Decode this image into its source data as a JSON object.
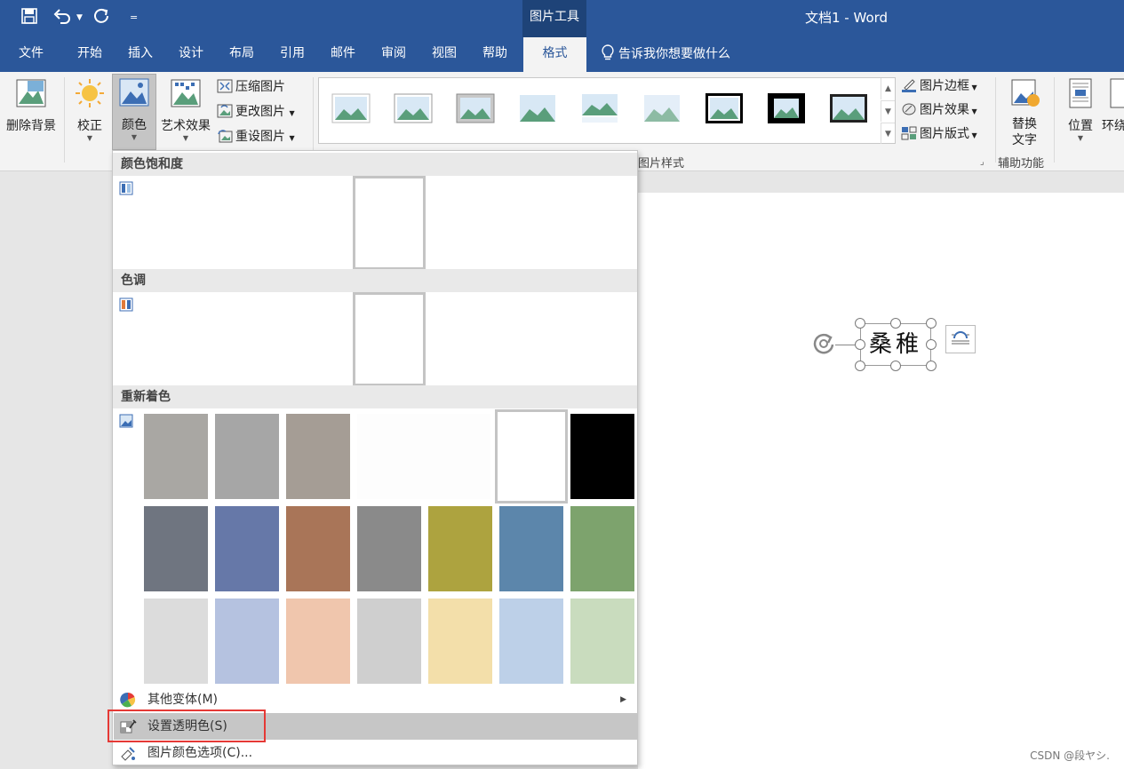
{
  "title_bar": {
    "save_icon": "save-icon",
    "undo_icon": "undo-icon",
    "redo_icon": "redo-icon",
    "customize_icon": "customize-qat-icon",
    "context_label": "图片工具",
    "document_title": "文档1  -  Word"
  },
  "tabs": [
    {
      "label": "文件"
    },
    {
      "label": "开始"
    },
    {
      "label": "插入"
    },
    {
      "label": "设计"
    },
    {
      "label": "布局"
    },
    {
      "label": "引用"
    },
    {
      "label": "邮件"
    },
    {
      "label": "审阅"
    },
    {
      "label": "视图"
    },
    {
      "label": "帮助"
    },
    {
      "label": "格式",
      "active": true
    }
  ],
  "tell_me": "告诉我你想要做什么",
  "ribbon": {
    "remove_bg": "删除背景",
    "corrections": "校正",
    "color": "颜色",
    "artistic": "艺术效果",
    "compress": "压缩图片",
    "change": "更改图片",
    "reset": "重设图片",
    "styles_group": "图片样式",
    "border": "图片边框",
    "effects": "图片效果",
    "layout": "图片版式",
    "alt_text_l1": "替换",
    "alt_text_l2": "文字",
    "accessibility_group": "辅助功能",
    "position": "位置",
    "wrap": "环绕"
  },
  "color_menu": {
    "saturation_header": "颜色饱和度",
    "tone_header": "色调",
    "recolor_header": "重新着色",
    "recolor_rows": [
      [
        "#a9a7a3",
        "#a6a6a6",
        "#a59d95",
        "#fdfdfd",
        "#ffffff",
        "#000000"
      ],
      [
        "#6f7580",
        "#6678a8",
        "#a97558",
        "#8a8a8a",
        "#ada33f",
        "#5c86ab",
        "#7da36d"
      ],
      [
        "#dcdcdc",
        "#b5c2e0",
        "#f0c6ad",
        "#cfcfcf",
        "#f3dfaa",
        "#bdd0e8",
        "#c9dcbe"
      ]
    ],
    "more_variations": "其他变体(M)",
    "set_transparent": "设置透明色(S)",
    "color_options": "图片颜色选项(C)..."
  },
  "document": {
    "picture_text": "桑稚"
  },
  "watermark": "CSDN @段ヤシ."
}
